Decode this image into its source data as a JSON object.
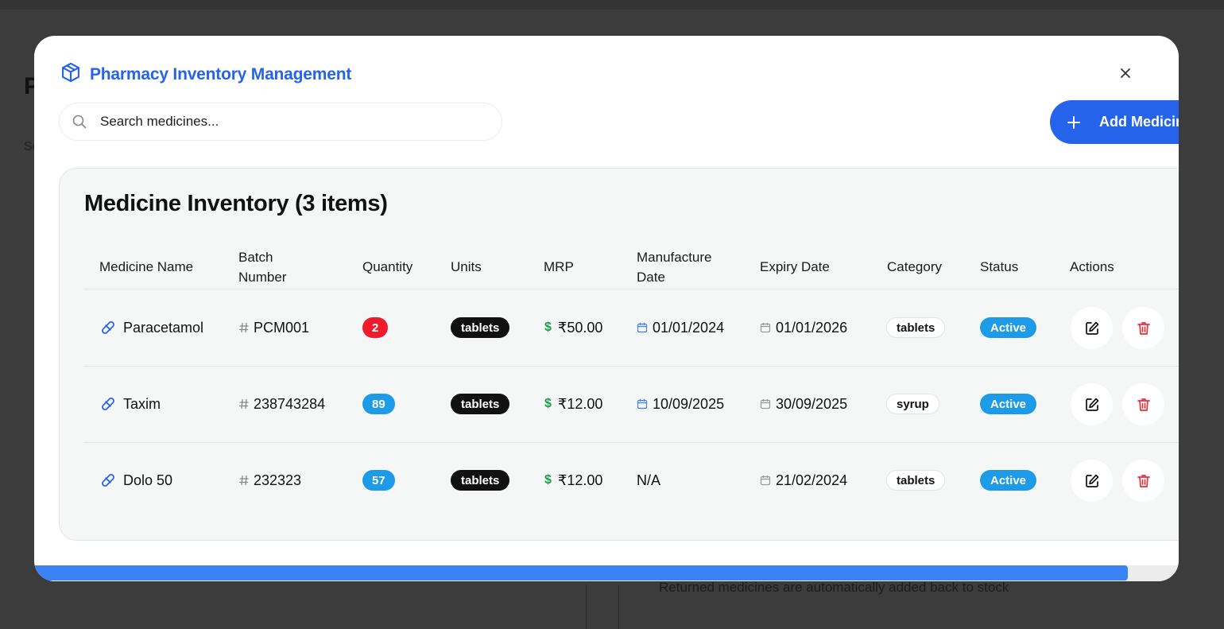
{
  "background": {
    "heading": "P",
    "subtext": "Se",
    "note": "Returned medicines are automatically added back to stock"
  },
  "modal": {
    "title": "Pharmacy Inventory Management",
    "title_icon": "package-icon",
    "close_icon": "close-icon"
  },
  "search": {
    "placeholder": "Search medicines..."
  },
  "add_button": {
    "label": "Add Medicine"
  },
  "inventory": {
    "title": "Medicine Inventory (3 items)",
    "columns": {
      "name": "Medicine Name",
      "batch_1": "Batch",
      "batch_2": "Number",
      "quantity": "Quantity",
      "units": "Units",
      "mrp": "MRP",
      "mfg_1": "Manufacture",
      "mfg_2": "Date",
      "expiry": "Expiry Date",
      "category": "Category",
      "status": "Status",
      "actions": "Actions"
    },
    "rows": [
      {
        "name": "Paracetamol",
        "batch": "PCM001",
        "quantity": "2",
        "units": "tablets",
        "mrp": "₹50.00",
        "manufacture": "01/01/2024",
        "expiry": "01/01/2026",
        "category": "tablets",
        "status": "Active"
      },
      {
        "name": "Taxim",
        "batch": "238743284",
        "quantity": "89",
        "units": "tablets",
        "mrp": "₹12.00",
        "manufacture": "10/09/2025",
        "expiry": "30/09/2025",
        "category": "syrup",
        "status": "Active"
      },
      {
        "name": "Dolo 50",
        "batch": "232323",
        "quantity": "57",
        "units": "tablets",
        "mrp": "₹12.00",
        "manufacture": "N/A",
        "expiry": "21/02/2024",
        "category": "tablets",
        "status": "Active"
      }
    ]
  },
  "colors": {
    "accent": "#2563eb",
    "qty_low": "#ef1c2e",
    "qty_ok": "#1e9be6",
    "status_active": "#1e9be6",
    "delete_red": "#e5323f",
    "mrp_green": "#16a34a"
  },
  "scroll_progress": 0.955
}
